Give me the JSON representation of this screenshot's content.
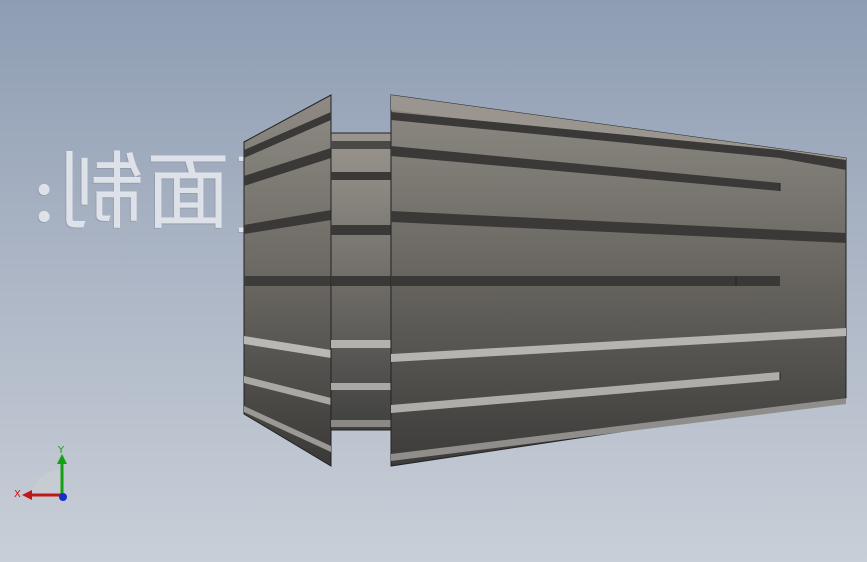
{
  "watermark": {
    "text": "[面制:"
  },
  "model": {
    "name": "collet",
    "colors": {
      "top": "#8b8780",
      "bottom": "#3e3d3b",
      "groove": "#3a3937",
      "groove_light": "#bdbcb8",
      "edge": "#222222"
    }
  },
  "triad": {
    "x_label": "X",
    "y_label": "Y",
    "colors": {
      "x": "#c01818",
      "y": "#14a014",
      "z": "#1830c8"
    }
  }
}
